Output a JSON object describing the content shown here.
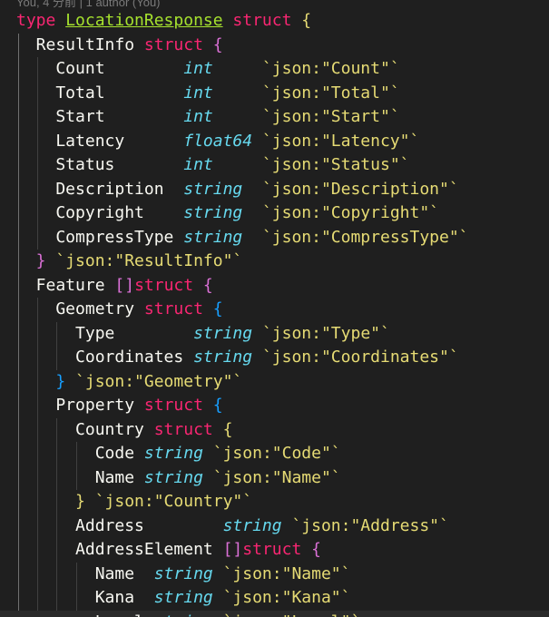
{
  "codelens": "You, 4 分前 | 1 author (You)",
  "lines": [
    [
      {
        "c": "kw",
        "t": "type "
      },
      {
        "c": "typename",
        "t": "LocationResponse"
      },
      {
        "c": "kw",
        "t": " struct "
      },
      {
        "c": "brace-y",
        "t": "{"
      }
    ],
    [
      {
        "c": "field",
        "t": "  ResultInfo "
      },
      {
        "c": "kw",
        "t": "struct "
      },
      {
        "c": "brace-p",
        "t": "{"
      }
    ],
    [
      {
        "c": "field",
        "t": "    Count        "
      },
      {
        "c": "ptype",
        "t": "int"
      },
      {
        "c": "tag",
        "t": "     `json:\"Count\"`"
      }
    ],
    [
      {
        "c": "field",
        "t": "    Total        "
      },
      {
        "c": "ptype",
        "t": "int"
      },
      {
        "c": "tag",
        "t": "     `json:\"Total\"`"
      }
    ],
    [
      {
        "c": "field",
        "t": "    Start        "
      },
      {
        "c": "ptype",
        "t": "int"
      },
      {
        "c": "tag",
        "t": "     `json:\"Start\"`"
      }
    ],
    [
      {
        "c": "field",
        "t": "    Latency      "
      },
      {
        "c": "ptype",
        "t": "float64"
      },
      {
        "c": "tag",
        "t": " `json:\"Latency\"`"
      }
    ],
    [
      {
        "c": "field",
        "t": "    Status       "
      },
      {
        "c": "ptype",
        "t": "int"
      },
      {
        "c": "tag",
        "t": "     `json:\"Status\"`"
      }
    ],
    [
      {
        "c": "field",
        "t": "    Description  "
      },
      {
        "c": "ptype",
        "t": "string"
      },
      {
        "c": "tag",
        "t": "  `json:\"Description\"`"
      }
    ],
    [
      {
        "c": "field",
        "t": "    Copyright    "
      },
      {
        "c": "ptype",
        "t": "string"
      },
      {
        "c": "tag",
        "t": "  `json:\"Copyright\"`"
      }
    ],
    [
      {
        "c": "field",
        "t": "    CompressType "
      },
      {
        "c": "ptype",
        "t": "string"
      },
      {
        "c": "tag",
        "t": "  `json:\"CompressType\"`"
      }
    ],
    [
      {
        "c": "brace-p",
        "t": "  }"
      },
      {
        "c": "tag",
        "t": " `json:\"ResultInfo\"`"
      }
    ],
    [
      {
        "c": "field",
        "t": "  Feature "
      },
      {
        "c": "bracket",
        "t": "[]"
      },
      {
        "c": "kw",
        "t": "struct "
      },
      {
        "c": "brace-p",
        "t": "{"
      }
    ],
    [
      {
        "c": "field",
        "t": "    Geometry "
      },
      {
        "c": "kw",
        "t": "struct "
      },
      {
        "c": "brace-b",
        "t": "{"
      }
    ],
    [
      {
        "c": "field",
        "t": "      Type        "
      },
      {
        "c": "ptype",
        "t": "string"
      },
      {
        "c": "tag",
        "t": " `json:\"Type\"`"
      }
    ],
    [
      {
        "c": "field",
        "t": "      Coordinates "
      },
      {
        "c": "ptype",
        "t": "string"
      },
      {
        "c": "tag",
        "t": " `json:\"Coordinates\"`"
      }
    ],
    [
      {
        "c": "brace-b",
        "t": "    }"
      },
      {
        "c": "tag",
        "t": " `json:\"Geometry\"`"
      }
    ],
    [
      {
        "c": "field",
        "t": "    Property "
      },
      {
        "c": "kw",
        "t": "struct "
      },
      {
        "c": "brace-b",
        "t": "{"
      }
    ],
    [
      {
        "c": "field",
        "t": "      Country "
      },
      {
        "c": "kw",
        "t": "struct "
      },
      {
        "c": "brace-y",
        "t": "{"
      }
    ],
    [
      {
        "c": "field",
        "t": "        Code "
      },
      {
        "c": "ptype",
        "t": "string"
      },
      {
        "c": "tag",
        "t": " `json:\"Code\"`"
      }
    ],
    [
      {
        "c": "field",
        "t": "        Name "
      },
      {
        "c": "ptype",
        "t": "string"
      },
      {
        "c": "tag",
        "t": " `json:\"Name\"`"
      }
    ],
    [
      {
        "c": "brace-y",
        "t": "      }"
      },
      {
        "c": "tag",
        "t": " `json:\"Country\"`"
      }
    ],
    [
      {
        "c": "field",
        "t": "      Address        "
      },
      {
        "c": "ptype",
        "t": "string"
      },
      {
        "c": "tag",
        "t": " `json:\"Address\"`"
      }
    ],
    [
      {
        "c": "field",
        "t": "      AddressElement "
      },
      {
        "c": "bracket",
        "t": "[]"
      },
      {
        "c": "kw",
        "t": "struct "
      },
      {
        "c": "brace-p",
        "t": "{"
      }
    ],
    [
      {
        "c": "field",
        "t": "        Name  "
      },
      {
        "c": "ptype",
        "t": "string"
      },
      {
        "c": "tag",
        "t": " `json:\"Name\"`"
      }
    ],
    [
      {
        "c": "field",
        "t": "        Kana  "
      },
      {
        "c": "ptype",
        "t": "string"
      },
      {
        "c": "tag",
        "t": " `json:\"Kana\"`"
      }
    ],
    [
      {
        "c": "field",
        "t": "        Level "
      },
      {
        "c": "ptype",
        "t": "string"
      },
      {
        "c": "tag",
        "t": " `json:\"Level\"`"
      }
    ]
  ],
  "colors": {
    "background": "#1f1f1f",
    "keyword": "#f92672",
    "type_name": "#a6e22e",
    "field": "#f8f8f2",
    "primitive_type": "#66d9ef",
    "tag": "#e6db74",
    "brace_magenta": "#da70d6",
    "brace_blue": "#179fff"
  }
}
